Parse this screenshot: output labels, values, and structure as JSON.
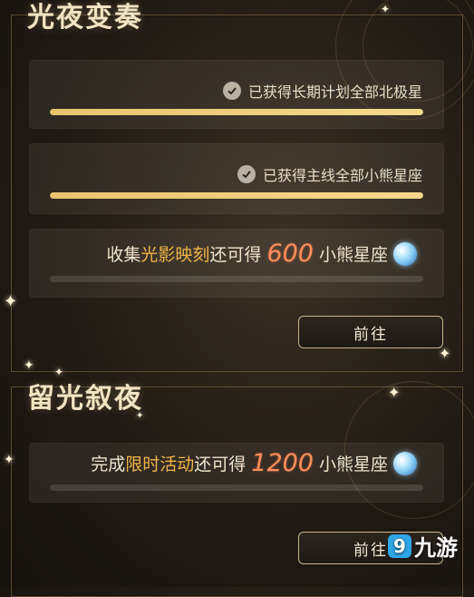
{
  "sections": [
    {
      "title": "光夜变奏",
      "claimed_rows": [
        {
          "label": "已获得长期计划全部北极星",
          "progress": 1.0,
          "icon": "check-icon"
        },
        {
          "label": "已获得主线全部小熊星座",
          "progress": 1.0,
          "icon": "check-icon"
        }
      ],
      "reward": {
        "prefix": "收集",
        "highlight": "光影映刻",
        "middle": "还可得",
        "amount": "600",
        "unit": "小熊星座",
        "icon": "gem-icon",
        "progress": 0
      },
      "button_label": "前往"
    },
    {
      "title": "留光叙夜",
      "reward": {
        "prefix": "完成",
        "highlight": "限时活动",
        "middle": "还可得",
        "amount": "1200",
        "unit": "小熊星座",
        "icon": "gem-icon",
        "progress": 0
      },
      "button_label": "前往"
    }
  ],
  "watermark": {
    "text": "九游",
    "logo": "9game-logo"
  },
  "colors": {
    "gold_bar": "#e8c46c",
    "highlight_text": "#f0b347",
    "amount_text": "#ff8e5a",
    "background": "#211b15"
  }
}
